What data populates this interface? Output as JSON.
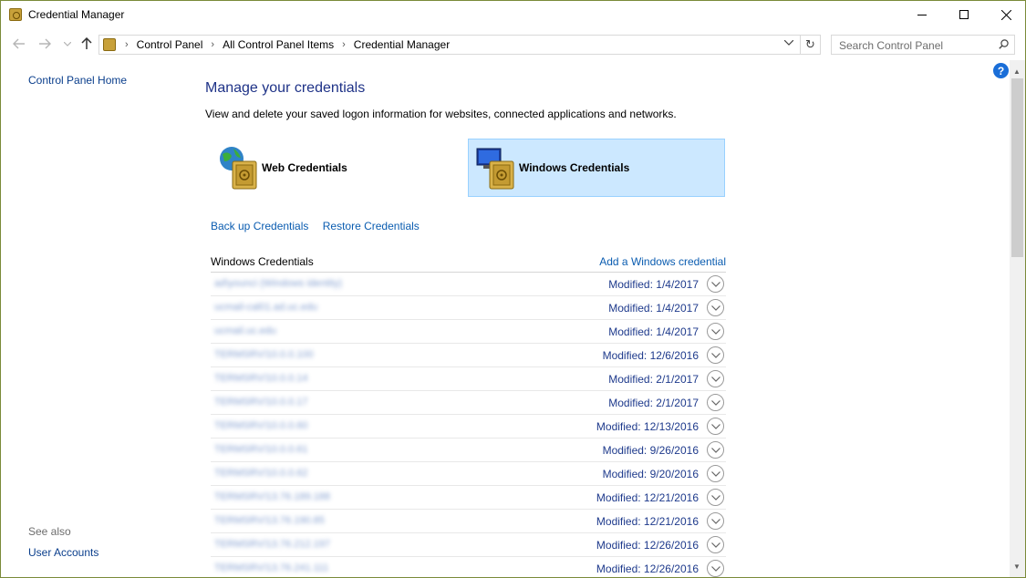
{
  "window": {
    "title": "Credential Manager"
  },
  "address": {
    "breadcrumbs": [
      "Control Panel",
      "All Control Panel Items",
      "Credential Manager"
    ]
  },
  "search": {
    "placeholder": "Search Control Panel"
  },
  "sidebar": {
    "home_link": "Control Panel Home",
    "see_also_label": "See also",
    "see_also_links": [
      "User Accounts"
    ]
  },
  "main": {
    "heading": "Manage your credentials",
    "description": "View and delete your saved logon information for websites, connected applications and networks.",
    "tiles": [
      {
        "label": "Web Credentials",
        "icon": "globe-vault-icon",
        "selected": false
      },
      {
        "label": "Windows Credentials",
        "icon": "computer-vault-icon",
        "selected": true
      }
    ],
    "backup_link": "Back up Credentials",
    "restore_link": "Restore Credentials"
  },
  "list": {
    "title": "Windows Credentials",
    "add_link": "Add a Windows credential",
    "rows": [
      {
        "name": "ad\\younci (Windows identity)",
        "modified": "Modified:  1/4/2017"
      },
      {
        "name": "ucmail-cal01.ad.uc.edu",
        "modified": "Modified:  1/4/2017"
      },
      {
        "name": "ucmail.uc.edu",
        "modified": "Modified:  1/4/2017"
      },
      {
        "name": "TERMSRV/10.0.0.100",
        "modified": "Modified:  12/6/2016"
      },
      {
        "name": "TERMSRV/10.0.0.14",
        "modified": "Modified:  2/1/2017"
      },
      {
        "name": "TERMSRV/10.0.0.17",
        "modified": "Modified:  2/1/2017"
      },
      {
        "name": "TERMSRV/10.0.0.60",
        "modified": "Modified:  12/13/2016"
      },
      {
        "name": "TERMSRV/10.0.0.61",
        "modified": "Modified:  9/26/2016"
      },
      {
        "name": "TERMSRV/10.0.0.62",
        "modified": "Modified:  9/20/2016"
      },
      {
        "name": "TERMSRV/13.76.189.188",
        "modified": "Modified:  12/21/2016"
      },
      {
        "name": "TERMSRV/13.76.190.85",
        "modified": "Modified:  12/21/2016"
      },
      {
        "name": "TERMSRV/13.76.212.197",
        "modified": "Modified:  12/26/2016"
      },
      {
        "name": "TERMSRV/13.76.241.111",
        "modified": "Modified:  12/26/2016"
      }
    ]
  },
  "colors": {
    "link": "#0a5cb0",
    "heading": "#1e3287",
    "selected_tile_bg": "#cce8ff",
    "window_border": "#7a8a3a"
  }
}
